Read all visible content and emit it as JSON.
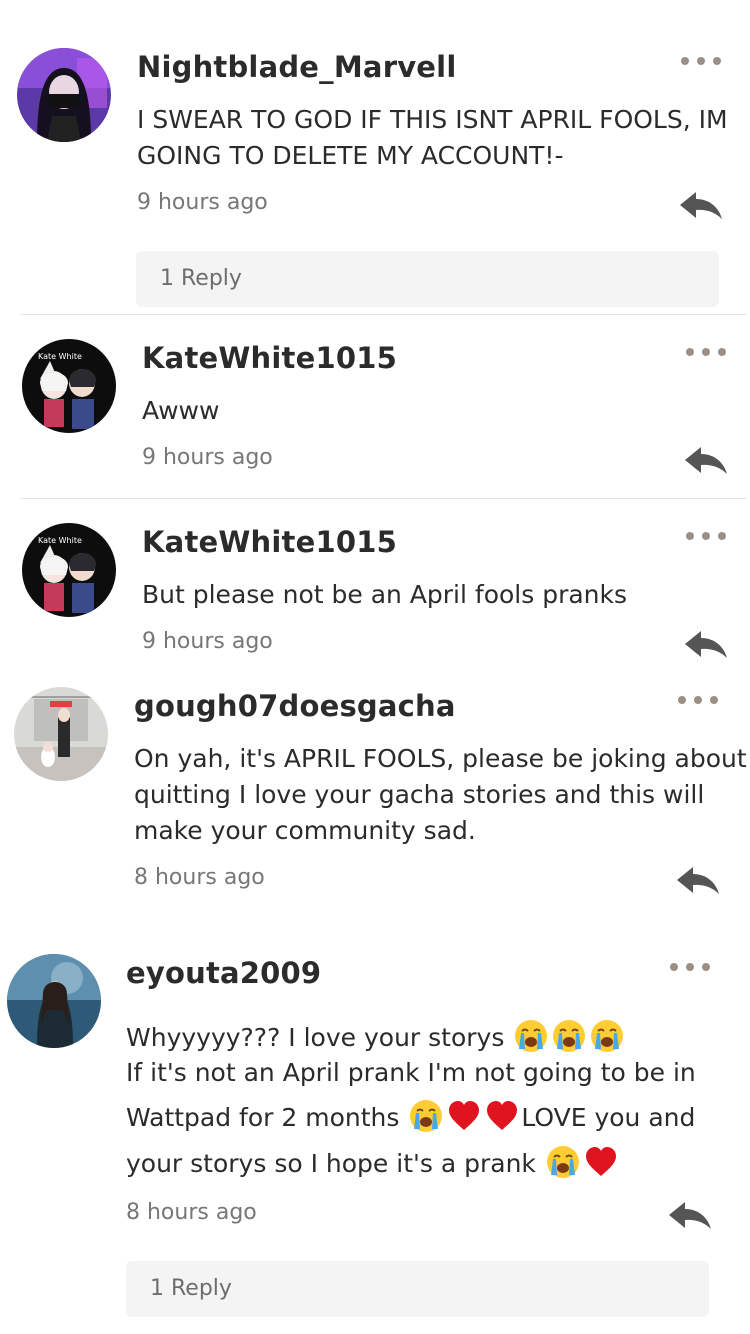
{
  "comments": [
    {
      "username": "Nightblade_Marvell",
      "lines": [
        "I SWEAR TO GOD IF THIS ISNT APRIL FOOLS, IM",
        "GOING TO DELETE MY ACCOUNT!-"
      ],
      "time": "9 hours ago",
      "replies_label": "1 Reply",
      "avatar_icon": "avatar-dark-hair-mask"
    },
    {
      "username": "KateWhite1015",
      "lines": [
        "Awww"
      ],
      "time": "9 hours ago",
      "avatar_text": "Kate White",
      "avatar_icon": "avatar-gacha-characters"
    },
    {
      "username": "KateWhite1015",
      "lines": [
        "But please not be an April fools pranks"
      ],
      "time": "9 hours ago",
      "avatar_text": "Kate White",
      "avatar_icon": "avatar-gacha-characters"
    },
    {
      "username": "gough07doesgacha",
      "lines": [
        "On yah, it's APRIL FOOLS, please be joking about",
        "quitting I love your gacha stories and this will",
        "make your community sad."
      ],
      "time": "8 hours ago",
      "avatar_icon": "avatar-hallway-characters"
    },
    {
      "username": "eyouta2009",
      "line1": "Whyyyyy??? I love your storys",
      "line2": "If it's not an April prank I'm not going to be in",
      "line3a": "Wattpad for 2 months",
      "line3b": "LOVE you and",
      "line4": "your storys so I hope it's a prank",
      "time": "8 hours ago",
      "replies_label": "1 Reply",
      "avatar_icon": "avatar-girl-blue-background"
    }
  ],
  "icons": {
    "more": "more-options-icon",
    "reply": "reply-arrow-icon",
    "crying": "loudly-crying-face-emoji",
    "heart": "red-heart-emoji"
  },
  "colors": {
    "heart": "#e0141e",
    "emoji_face": "#ffcc33",
    "tears": "#4aa8e8",
    "reply_icon": "#555555",
    "dots": "#9a8f86"
  }
}
